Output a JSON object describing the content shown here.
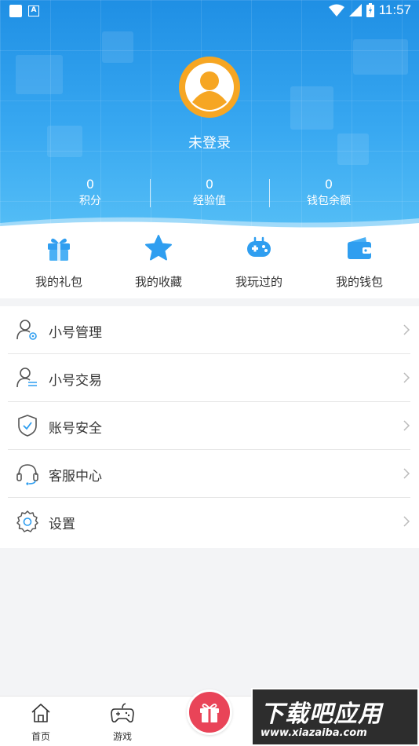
{
  "status_bar": {
    "time": "11:57"
  },
  "profile": {
    "username": "未登录"
  },
  "stats": [
    {
      "value": "0",
      "label": "积分"
    },
    {
      "value": "0",
      "label": "经验值"
    },
    {
      "value": "0",
      "label": "钱包余额"
    }
  ],
  "quick_actions": [
    {
      "label": "我的礼包",
      "icon": "gift-icon"
    },
    {
      "label": "我的收藏",
      "icon": "star-icon"
    },
    {
      "label": "我玩过的",
      "icon": "gamepad-icon"
    },
    {
      "label": "我的钱包",
      "icon": "wallet-icon"
    }
  ],
  "menu": [
    {
      "label": "小号管理",
      "icon": "user-settings-icon"
    },
    {
      "label": "小号交易",
      "icon": "user-trade-icon"
    },
    {
      "label": "账号安全",
      "icon": "shield-check-icon"
    },
    {
      "label": "客服中心",
      "icon": "headset-icon"
    },
    {
      "label": "设置",
      "icon": "gear-icon"
    }
  ],
  "bottom_nav": [
    {
      "label": "首页",
      "icon": "home-icon"
    },
    {
      "label": "游戏",
      "icon": "controller-icon"
    },
    {
      "label": "",
      "icon": "gift-icon"
    }
  ],
  "watermark": {
    "title": "下载吧应用",
    "url": "www.xiazaiba.com"
  },
  "colors": {
    "header_blue": "#2a9bea",
    "accent_blue": "#2f9ef0",
    "avatar_orange": "#f6a623",
    "gift_red": "#e94458"
  }
}
